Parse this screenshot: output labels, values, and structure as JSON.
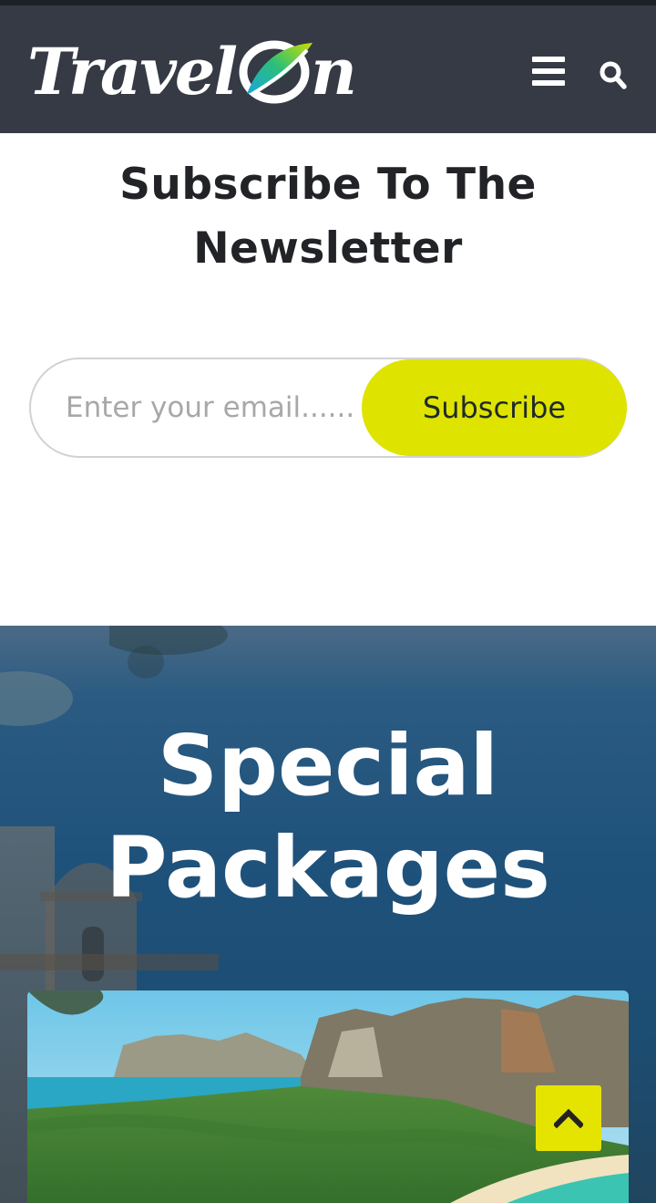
{
  "header": {
    "logo_text_left": "Travel",
    "logo_text_right": "n",
    "menu_icon": "hamburger-menu-icon",
    "search_icon": "search-icon",
    "background": "#353a44"
  },
  "newsletter": {
    "title": "Subscribe To The Newsletter",
    "email_placeholder": "Enter your email........",
    "subscribe_label": "Subscribe",
    "button_color": "#dfe300"
  },
  "packages": {
    "title": "Special Packages",
    "scroll_top_icon": "chevron-up-icon",
    "scroll_top_color": "#e5e300"
  }
}
